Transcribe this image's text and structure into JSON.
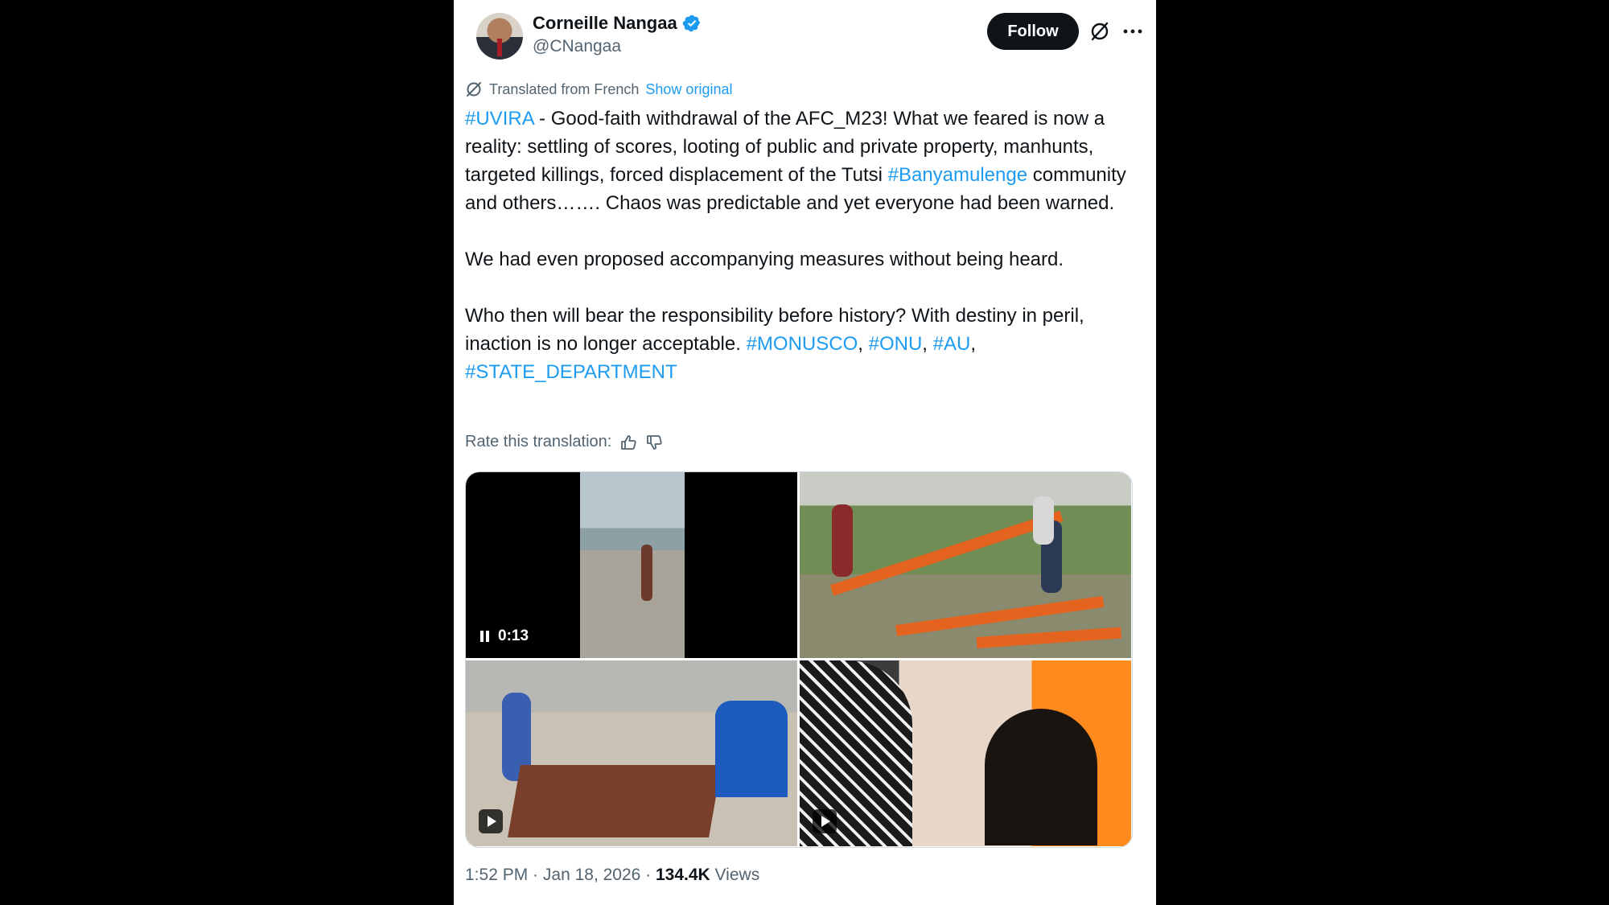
{
  "author": {
    "display_name": "Corneille Nangaa",
    "handle": "@CNangaa",
    "verified": true
  },
  "actions": {
    "follow_label": "Follow",
    "grok_icon": "grok-icon",
    "more_icon": "more-icon"
  },
  "translation": {
    "label": "Translated from French",
    "show_original": "Show original",
    "rate_label": "Rate this translation:"
  },
  "tweet": {
    "p1": {
      "tag1": "#UVIRA",
      "text1": " - Good-faith withdrawal of the AFC_M23! What we feared is now a reality: settling of scores, looting of public and private property, manhunts, targeted killings, forced displacement of the Tutsi ",
      "tag2": "#Banyamulenge",
      "text2": " community and others……. Chaos was predictable and yet everyone had been warned."
    },
    "p2": "We had even proposed accompanying measures without being heard.",
    "p3": {
      "text1": "Who then will bear the responsibility before history? With destiny in peril, inaction is no longer acceptable. ",
      "tag1": "#MONUSCO",
      "sep1": ", ",
      "tag2": "#ONU",
      "sep2": ", ",
      "tag3": "#AU",
      "sep3": ",",
      "tag4": "#STATE_DEPARTMENT"
    }
  },
  "media": {
    "video_time": "0:13"
  },
  "meta": {
    "time": "1:52 PM",
    "date": "Jan 18, 2026",
    "separator": " · ",
    "views_count": "134.4K",
    "views_label": " Views"
  },
  "colors": {
    "link": "#1d9bf0",
    "text": "#0f1419",
    "secondary": "#536471",
    "background": "#000000"
  }
}
